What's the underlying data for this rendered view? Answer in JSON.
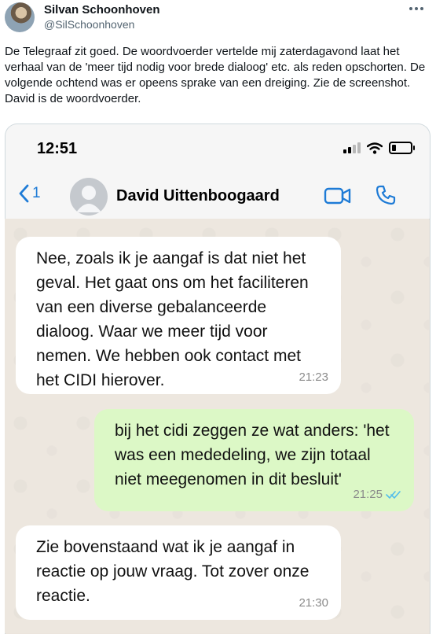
{
  "tweet": {
    "author_name": "Silvan Schoonhoven",
    "author_handle": "@SilSchoonhoven",
    "text": "De Telegraaf zit goed. De woordvoerder vertelde mij zaterdagavond laat het verhaal van de 'meer tijd nodig voor brede dialoog' etc. als reden opschorten.  De volgende ochtend was er opeens sprake van een dreiging. Zie de screenshot. David is de woordvoerder.",
    "more_icon": "more-horizontal-icon"
  },
  "whatsapp": {
    "status_time": "12:51",
    "back_count": "1",
    "contact_name": "David Uittenboogaard",
    "icons": {
      "back": "chevron-left-icon",
      "video": "video-call-icon",
      "phone": "phone-call-icon",
      "signal": "signal-icon",
      "wifi": "wifi-icon",
      "battery": "battery-icon"
    },
    "colors": {
      "accent": "#1e7bd6",
      "incoming_bubble": "#ffffff",
      "outgoing_bubble": "#dcf8c6",
      "read_ticks": "#53bdeb"
    },
    "messages": [
      {
        "direction": "incoming",
        "text": "Nee, zoals ik je aangaf is dat niet het geval. Het gaat ons om het faciliteren van een diverse gebalanceerde dialoog. Waar we meer tijd voor nemen. We hebben ook contact met het CIDI hierover.",
        "time": "21:23"
      },
      {
        "direction": "outgoing",
        "text": "bij het cidi zeggen ze wat anders: 'het was een mededeling, we zijn totaal niet meegenomen in dit besluit'",
        "time": "21:25",
        "status": "read"
      },
      {
        "direction": "incoming",
        "text": "Zie bovenstaand wat ik je aangaf in reactie op jouw vraag. Tot zover onze reactie.",
        "time": "21:30"
      }
    ]
  }
}
